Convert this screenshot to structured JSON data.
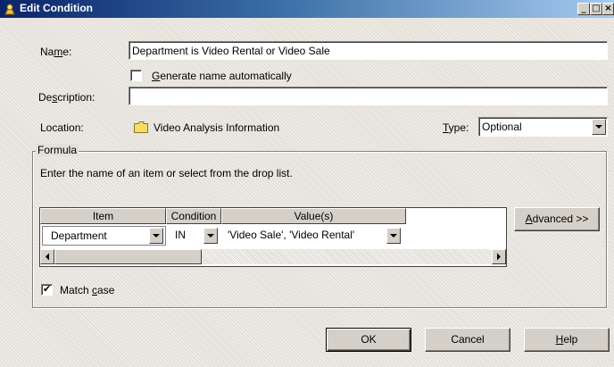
{
  "window": {
    "title": "Edit Condition",
    "buttons": {
      "minimize": "_",
      "maximize": "□",
      "close": "×"
    }
  },
  "name": {
    "label_before": "Na",
    "label_ul": "m",
    "label_after": "e:",
    "value": "Department is Video Rental or Video Sale"
  },
  "generate": {
    "label_ul": "G",
    "label_rest": "enerate name automatically",
    "checked": false
  },
  "description": {
    "label_before": "De",
    "label_ul": "s",
    "label_after": "cription:",
    "value": ""
  },
  "location": {
    "label": "Location:",
    "value": "Video Analysis Information",
    "icon": "folder-icon"
  },
  "type": {
    "label_ul": "T",
    "label_rest": "ype:",
    "value": "Optional"
  },
  "formula": {
    "title": "Formula",
    "instruction": "Enter the name of an item or select from the drop list.",
    "columns": [
      "Item",
      "Condition",
      "Value(s)"
    ],
    "rows": [
      {
        "item": "Department",
        "condition": "IN",
        "values": "'Video Sale', 'Video Rental'"
      }
    ]
  },
  "advanced": {
    "label_ul": "A",
    "label_rest": "dvanced >>"
  },
  "match_case": {
    "label_before": "Match ",
    "label_ul": "c",
    "label_rest": "ase",
    "checked": true,
    "mark": "✔"
  },
  "buttons": {
    "ok": "OK",
    "cancel": "Cancel",
    "help_ul": "H",
    "help_rest": "elp"
  }
}
